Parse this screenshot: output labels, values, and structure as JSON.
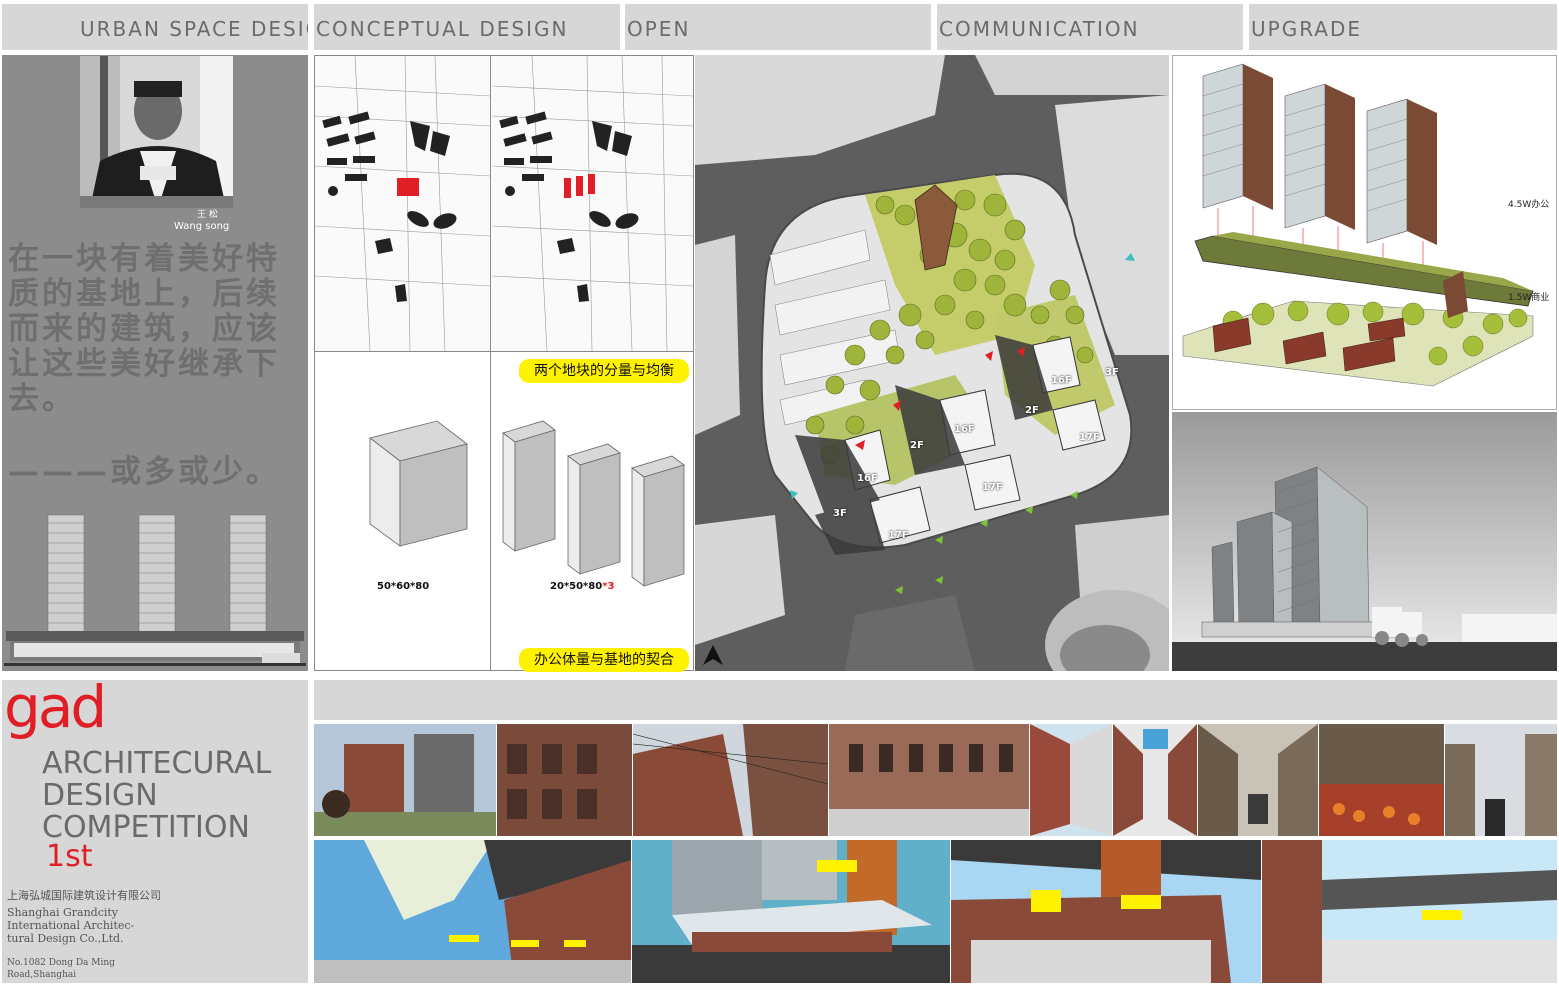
{
  "nav": {
    "items": [
      "URBAN SPACE DESIGN",
      "CONCEPTUAL DESIGN",
      "OPEN",
      "COMMUNICATION",
      "UPGRADE"
    ]
  },
  "profile": {
    "name_cn": "王  松",
    "name_en": "Wang song"
  },
  "statement": {
    "lines": [
      "在一块有着美好特",
      "质的基地上，后续",
      "而来的建筑，应该",
      "让这些美好继承下",
      "去。"
    ],
    "tagline": "———或多或少。"
  },
  "concept": {
    "label_balance": "两个地块的分量与均衡",
    "label_fit": "办公体量与基地的契合",
    "dim_single": "50*60*80",
    "dim_triple_base": "20*50*80",
    "dim_triple_mult": "*3"
  },
  "site_plan": {
    "floors": [
      "16F",
      "16F",
      "16F",
      "17F",
      "17F",
      "17F",
      "3F",
      "3F",
      "2F",
      "2F"
    ]
  },
  "exploded": {
    "label_office": "4.5W办公",
    "label_commercial": "1.5W商业"
  },
  "brand": {
    "logo": "gad",
    "competition_line1": "ARCHITECURAL",
    "competition_line2": "DESIGN",
    "competition_line3": "COMPETITION",
    "rank": "1st",
    "company_cn": "上海弘城国际建筑设计有限公司",
    "company_en_1": "Shanghai Grandcity",
    "company_en_2": "International Architec-",
    "company_en_3": "tural Design Co.,Ltd.",
    "address_1": "No.1082 Dong Da Ming",
    "address_2": "Road,Shanghai"
  },
  "colors": {
    "accent_red": "#e01e26",
    "highlight_yellow": "#fff200",
    "panel_gray": "#8c8c8c"
  }
}
